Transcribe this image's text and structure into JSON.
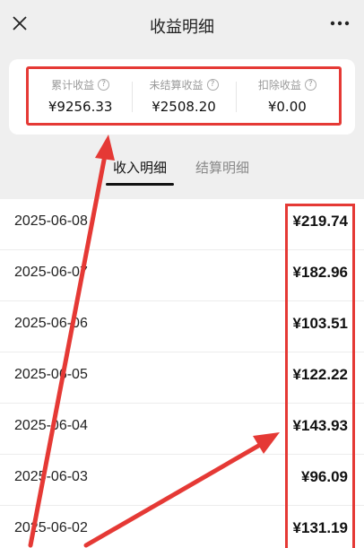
{
  "nav": {
    "title": "收益明细",
    "close_icon": "close-icon",
    "more_icon": "more-icon"
  },
  "summary": {
    "stats": [
      {
        "label": "累计收益",
        "value": "¥9256.33",
        "help_icon": "help-icon"
      },
      {
        "label": "未结算收益",
        "value": "¥2508.20",
        "help_icon": "help-icon"
      },
      {
        "label": "扣除收益",
        "value": "¥0.00",
        "help_icon": "help-icon"
      }
    ]
  },
  "tabs": [
    {
      "label": "收入明细",
      "active": true
    },
    {
      "label": "结算明细",
      "active": false
    }
  ],
  "rows": [
    {
      "date": "2025-06-08",
      "amount": "¥219.74"
    },
    {
      "date": "2025-06-07",
      "amount": "¥182.96"
    },
    {
      "date": "2025-06-06",
      "amount": "¥103.51"
    },
    {
      "date": "2025-06-05",
      "amount": "¥122.22"
    },
    {
      "date": "2025-06-04",
      "amount": "¥143.93"
    },
    {
      "date": "2025-06-03",
      "amount": "¥96.09"
    },
    {
      "date": "2025-06-02",
      "amount": "¥131.19"
    }
  ],
  "colors": {
    "annotation": "#e53935",
    "background": "#efefef",
    "card": "#ffffff"
  }
}
